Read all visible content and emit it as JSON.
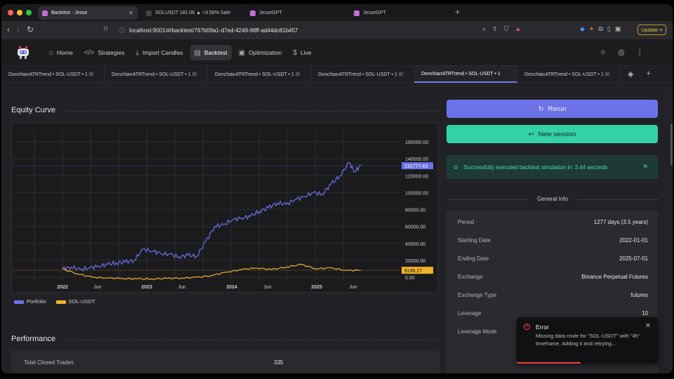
{
  "browser": {
    "tabs": [
      {
        "title": "Backtest - Jesse",
        "active": true
      },
      {
        "title": "SOLUSDT 181.06 ▲ +3.56% Sale",
        "active": false
      },
      {
        "title": "JesseGPT",
        "active": false
      },
      {
        "title": "JesseGPT",
        "active": false
      }
    ],
    "url": "localhost:9001/#/backtest/767b09a1-d7ed-4249-98ff-ad44dc81b457",
    "update_label": "Update"
  },
  "nav": {
    "items": [
      {
        "label": "Home",
        "icon": "home-icon"
      },
      {
        "label": "Strategies",
        "icon": "code-icon"
      },
      {
        "label": "Import Candles",
        "icon": "download-icon"
      },
      {
        "label": "Backtest",
        "icon": "backtest-icon"
      },
      {
        "label": "Optimization",
        "icon": "chip-icon"
      },
      {
        "label": "Live",
        "icon": "dollar-icon"
      }
    ],
    "active": "Backtest"
  },
  "session_tabs": [
    {
      "label": "DonchianATRTrend • SOL-USDT • 1",
      "active": false
    },
    {
      "label": "DonchianATRTrend • SOL-USDT • 1",
      "active": false
    },
    {
      "label": "DonchianATRTrend • SOL-USDT • 1",
      "active": false
    },
    {
      "label": "DonchianATRTrend • SOL-USDT • 1",
      "active": false
    },
    {
      "label": "DonchianATRTrend • SOL-USDT • 1",
      "active": true
    },
    {
      "label": "DonchianATRTrend • SOL-USDT • 1",
      "active": false
    }
  ],
  "equity": {
    "title": "Equity Curve",
    "legend": [
      {
        "name": "Portfolio",
        "color": "#6c72e8"
      },
      {
        "name": "SOL-USDT",
        "color": "#f0b429"
      }
    ]
  },
  "chart_data": {
    "type": "line",
    "title": "Equity Curve",
    "x_ticks": [
      "2022",
      "Jun",
      "2023",
      "Jun",
      "2024",
      "Jun",
      "2025",
      "Jun"
    ],
    "y_ticks": [
      "160000.00",
      "140000.00",
      "120000.00",
      "100000.00",
      "80000.00",
      "60000.00",
      "40000.00",
      "20000.00",
      "0.00"
    ],
    "ylim": [
      -5000,
      175000
    ],
    "last_labels": {
      "portfolio": "131777.43",
      "sol": "8198.27"
    },
    "series": [
      {
        "name": "Portfolio",
        "color": "#6c72e8",
        "x": [
          0,
          0.03,
          0.06,
          0.09,
          0.12,
          0.15,
          0.18,
          0.21,
          0.24,
          0.27,
          0.3,
          0.33,
          0.36,
          0.39,
          0.42,
          0.45,
          0.48,
          0.51,
          0.54,
          0.57,
          0.6,
          0.63,
          0.66,
          0.69,
          0.72,
          0.75,
          0.78,
          0.81,
          0.84,
          0.87,
          0.9,
          0.93,
          0.96,
          0.98,
          1.0
        ],
        "y": [
          10000,
          12000,
          9000,
          11000,
          13000,
          15000,
          17000,
          18000,
          20000,
          33000,
          31000,
          28000,
          27000,
          24000,
          26000,
          25000,
          42000,
          60000,
          62000,
          68000,
          70000,
          72000,
          78000,
          82000,
          88000,
          86000,
          92000,
          95000,
          100000,
          98000,
          110000,
          120000,
          135000,
          125000,
          132000
        ]
      },
      {
        "name": "SOL-USDT",
        "color": "#f0b429",
        "x": [
          0,
          0.05,
          0.1,
          0.15,
          0.2,
          0.25,
          0.3,
          0.35,
          0.4,
          0.45,
          0.5,
          0.55,
          0.6,
          0.65,
          0.7,
          0.75,
          0.8,
          0.85,
          0.9,
          0.95,
          1.0
        ],
        "y": [
          10000,
          4000,
          0,
          -1000,
          -1500,
          -2000,
          -2000,
          -1500,
          -1000,
          0,
          2000,
          6000,
          9000,
          11000,
          9000,
          12000,
          15000,
          10000,
          11000,
          8000,
          8198
        ]
      }
    ]
  },
  "performance": {
    "title": "Performance",
    "rows": [
      {
        "label": "Total Closed Trades",
        "value": "335"
      }
    ]
  },
  "actions": {
    "rerun": "Rerun",
    "new_session": "New session"
  },
  "success_msg": "Successfully executed backtest simulation in: 3.44 seconds",
  "general_info": {
    "title": "General Info",
    "rows": [
      {
        "label": "Period",
        "value": "1277 days (3.5 years)"
      },
      {
        "label": "Starting Date",
        "value": "2022-01-01"
      },
      {
        "label": "Ending Date",
        "value": "2025-07-01"
      },
      {
        "label": "Exchange",
        "value": "Binance Perpetual Futures"
      },
      {
        "label": "Exchange Type",
        "value": "futures"
      },
      {
        "label": "Leverage",
        "value": "10"
      },
      {
        "label": "Leverage Mode",
        "value": ""
      }
    ]
  },
  "toast": {
    "title": "Error",
    "message": "Missing data route for \"SOL-USDT\" with \"4h\" timeframe. Adding it and retrying..."
  }
}
